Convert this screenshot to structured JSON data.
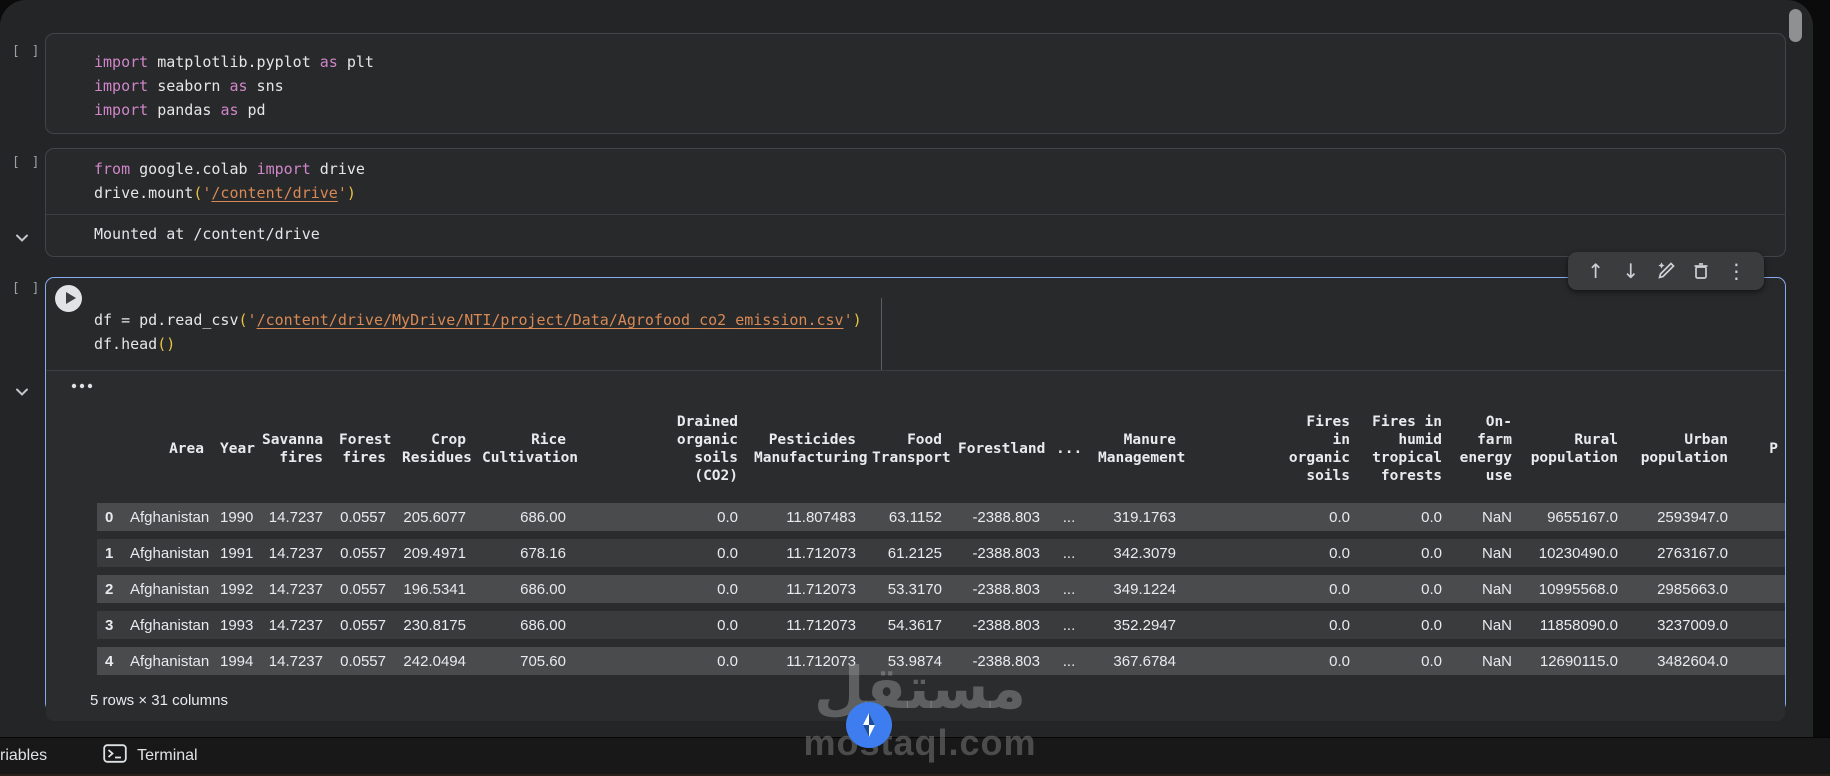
{
  "notebook": {
    "cells": [
      {
        "exec_indicator": "[ ]",
        "code": [
          [
            [
              "k",
              "import"
            ],
            [
              "p",
              " matplotlib.pyplot "
            ],
            [
              "k",
              "as"
            ],
            [
              "p",
              " plt"
            ]
          ],
          [
            [
              "k",
              "import"
            ],
            [
              "p",
              " seaborn "
            ],
            [
              "k",
              "as"
            ],
            [
              "p",
              " sns"
            ]
          ],
          [
            [
              "k",
              "import"
            ],
            [
              "p",
              " pandas "
            ],
            [
              "k",
              "as"
            ],
            [
              "p",
              " pd"
            ]
          ]
        ]
      },
      {
        "exec_indicator": "[ ]",
        "code": [
          [
            [
              "k",
              "from"
            ],
            [
              "p",
              " google.colab "
            ],
            [
              "k",
              "import"
            ],
            [
              "p",
              " drive"
            ]
          ],
          [
            [
              "p",
              "drive.mount"
            ],
            [
              "y",
              "("
            ],
            [
              "s",
              "'"
            ],
            [
              "u",
              "/content/drive"
            ],
            [
              "s",
              "'"
            ],
            [
              "y",
              ")"
            ]
          ]
        ],
        "output_text": "Mounted at /content/drive"
      },
      {
        "exec_indicator": "[ ]",
        "code": [
          [
            [
              "p",
              "df = pd.read_csv"
            ],
            [
              "y",
              "("
            ],
            [
              "s",
              "'"
            ],
            [
              "u",
              "/content/drive/MyDrive/NTI/project/Data/Agrofood_co2_emission.csv"
            ],
            [
              "s",
              "'"
            ],
            [
              "y",
              ")"
            ]
          ],
          [
            [
              "p",
              "df.head"
            ],
            [
              "y",
              "("
            ],
            [
              "y",
              ")"
            ]
          ]
        ]
      }
    ]
  },
  "cell_toolbar": {
    "icons": [
      "arrow-up",
      "arrow-down",
      "edit-with-ai-pencil",
      "trash",
      "more-vert"
    ],
    "glyphs": {
      "up": "↑",
      "down": "↓",
      "more": "⋮"
    }
  },
  "dataframe": {
    "more_button": "⋯",
    "headers": [
      "",
      "Area",
      "Year",
      "Savanna\nfires",
      "Forest\nfires",
      "Crop\nResidues",
      "Rice\nCultivation",
      "Drained\norganic\nsoils\n(CO2)",
      "Pesticides\nManufacturing",
      "Food\nTransport",
      "Forestland",
      "...",
      "Manure\nManagement",
      "Fires\nin\norganic\nsoils",
      "Fires in\nhumid\ntropical\nforests",
      "On-\nfarm\nenergy\nuse",
      "Rural\npopulation",
      "Urban\npopulation",
      "P"
    ],
    "rows": [
      [
        "0",
        "Afghanistan",
        "1990",
        "14.7237",
        "0.0557",
        "205.6077",
        "686.00",
        "0.0",
        "11.807483",
        "63.1152",
        "-2388.803",
        "...",
        "319.1763",
        "0.0",
        "0.0",
        "NaN",
        "9655167.0",
        "2593947.0",
        ""
      ],
      [
        "1",
        "Afghanistan",
        "1991",
        "14.7237",
        "0.0557",
        "209.4971",
        "678.16",
        "0.0",
        "11.712073",
        "61.2125",
        "-2388.803",
        "...",
        "342.3079",
        "0.0",
        "0.0",
        "NaN",
        "10230490.0",
        "2763167.0",
        ""
      ],
      [
        "2",
        "Afghanistan",
        "1992",
        "14.7237",
        "0.0557",
        "196.5341",
        "686.00",
        "0.0",
        "11.712073",
        "53.3170",
        "-2388.803",
        "...",
        "349.1224",
        "0.0",
        "0.0",
        "NaN",
        "10995568.0",
        "2985663.0",
        ""
      ],
      [
        "3",
        "Afghanistan",
        "1993",
        "14.7237",
        "0.0557",
        "230.8175",
        "686.00",
        "0.0",
        "11.712073",
        "54.3617",
        "-2388.803",
        "...",
        "352.2947",
        "0.0",
        "0.0",
        "NaN",
        "11858090.0",
        "3237009.0",
        ""
      ],
      [
        "4",
        "Afghanistan",
        "1994",
        "14.7237",
        "0.0557",
        "242.0494",
        "705.60",
        "0.0",
        "11.712073",
        "53.9874",
        "-2388.803",
        "...",
        "367.6784",
        "0.0",
        "0.0",
        "NaN",
        "12690115.0",
        "3482604.0",
        ""
      ]
    ],
    "footer": "5 rows × 31 columns"
  },
  "statusbar": {
    "variables_label": "riables",
    "terminal_label": "Terminal"
  },
  "watermark": {
    "title_arabic": "مستقل",
    "domain": "mostaql.com"
  },
  "colors": {
    "selected_cell_border": "#86abf2",
    "row_even": "#4a4b4d",
    "row_odd": "#3a3b3d",
    "keyword": "#cf86c8",
    "string": "#d88956",
    "paren": "#e9c341"
  }
}
